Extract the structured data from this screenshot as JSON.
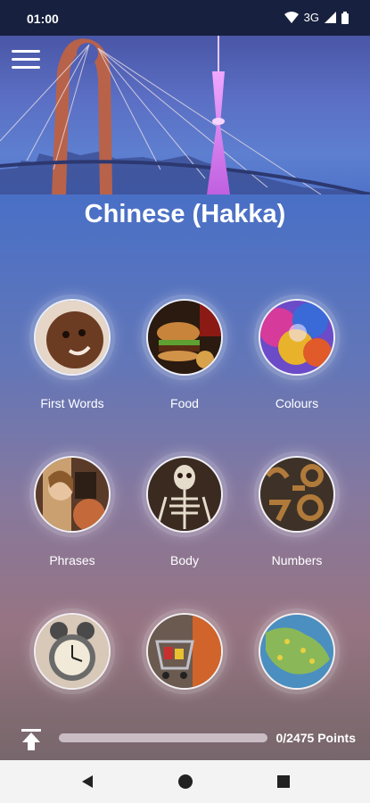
{
  "status": {
    "time": "01:00",
    "network": "3G"
  },
  "app": {
    "title": "Chinese (Hakka)"
  },
  "categories": [
    {
      "label": "First Words",
      "icon": "child-face-photo"
    },
    {
      "label": "Food",
      "icon": "burger-photo"
    },
    {
      "label": "Colours",
      "icon": "colour-powder-photo"
    },
    {
      "label": "Phrases",
      "icon": "people-talking-photo"
    },
    {
      "label": "Body",
      "icon": "skeleton-photo"
    },
    {
      "label": "Numbers",
      "icon": "metal-numbers-photo"
    },
    {
      "label": "",
      "icon": "alarm-clock-photo"
    },
    {
      "label": "",
      "icon": "shopping-trolley-photo"
    },
    {
      "label": "",
      "icon": "world-map-photo"
    }
  ],
  "progress": {
    "text": "0/2475 Points",
    "fraction": 0
  }
}
